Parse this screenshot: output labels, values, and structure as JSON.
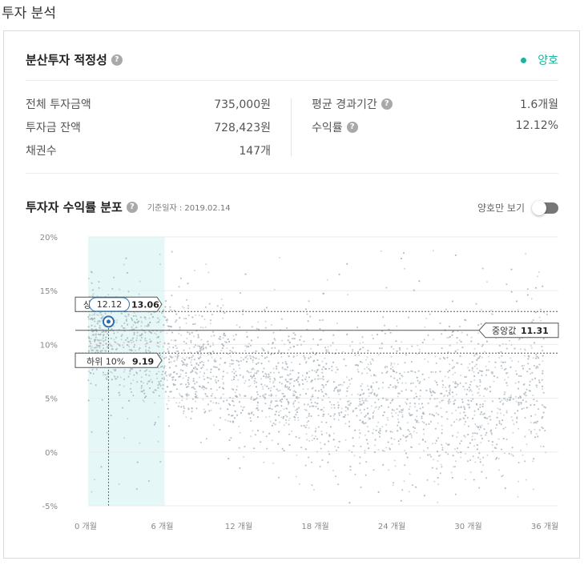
{
  "page": {
    "title": "투자 분석"
  },
  "suitability": {
    "title": "분산투자 적정성",
    "status_label": "양호",
    "status_color": "#1ab39b",
    "stats_left": [
      {
        "label": "전체 투자금액",
        "value": "735,000원"
      },
      {
        "label": "투자금 잔액",
        "value": "728,423원"
      },
      {
        "label": "채권수",
        "value": "147개"
      }
    ],
    "stats_right": [
      {
        "label": "평균 경과기간",
        "value": "1.6개월",
        "help": true
      },
      {
        "label": "수익률",
        "value": "12.12%",
        "help": true
      }
    ]
  },
  "distribution": {
    "title": "투자자 수익률 분포",
    "as_of": "기준일자 : 2019.02.14",
    "toggle_label": "양호만 보기",
    "toggle_on": false
  },
  "chart_data": {
    "type": "scatter",
    "x_ticks": [
      "0 개월",
      "6 개월",
      "12 개월",
      "18 개월",
      "24 개월",
      "30 개월",
      "36 개월"
    ],
    "y_ticks": [
      "20%",
      "15%",
      "10%",
      "5%",
      "0%",
      "-5%"
    ],
    "xlim": [
      0,
      36
    ],
    "ylim": [
      -5,
      20
    ],
    "grid": true,
    "highlight_band_months": [
      0,
      6
    ],
    "my_point": {
      "x": 1.6,
      "y": 12.12,
      "label": "12.12"
    },
    "upper_10": {
      "value": 13.06,
      "label": "상위 10%",
      "value_label": "13.06"
    },
    "median": {
      "value": 11.31,
      "label": "중앙값",
      "value_label": "11.31"
    },
    "lower_10": {
      "value": 9.19,
      "label": "하위 10%",
      "value_label": "9.19"
    },
    "colors": {
      "points": "#aab5bb",
      "band": "#e5f7f6",
      "marker": "#2f6fb0",
      "line": "#555555"
    }
  }
}
